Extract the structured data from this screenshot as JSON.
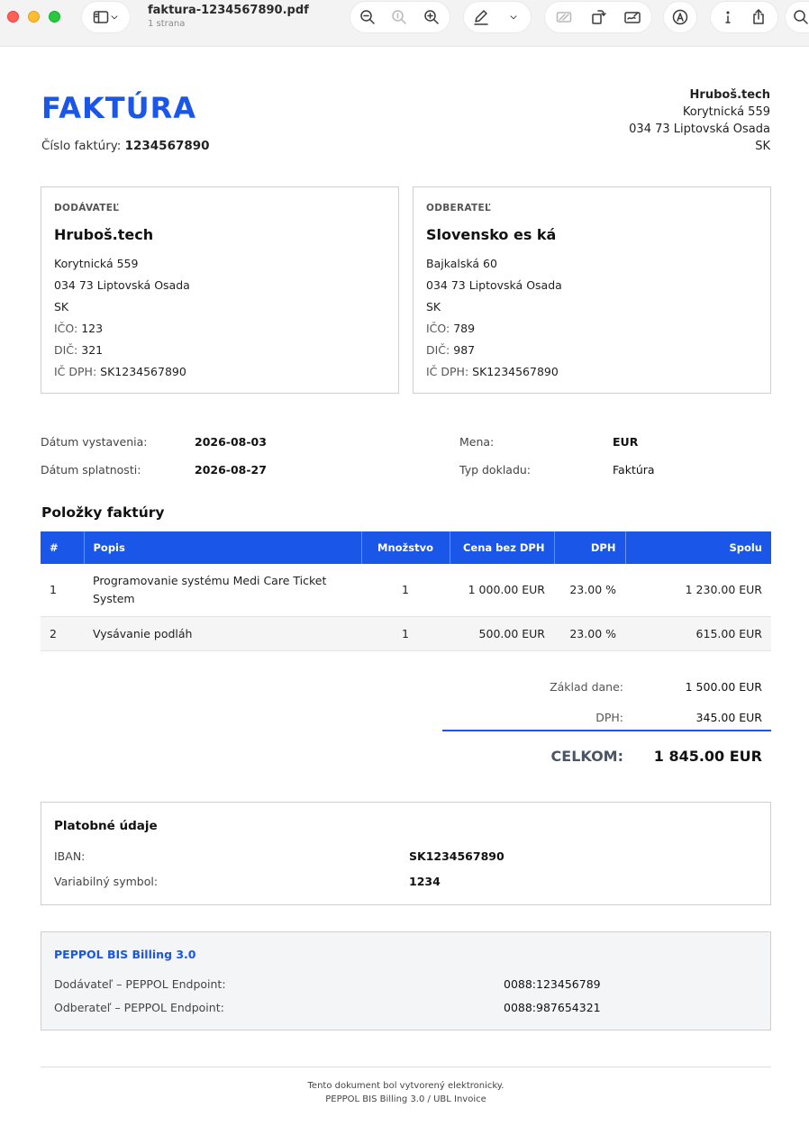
{
  "toolbar": {
    "file_name": "faktura-1234567890.pdf",
    "page_count": "1 strana"
  },
  "invoice": {
    "title": "FAKTÚRA",
    "number_label": "Číslo faktúry:",
    "number": "1234567890"
  },
  "header_right": {
    "name": "Hruboš.tech",
    "street": "Korytnická 559",
    "city": "034 73 Liptovská Osada",
    "country": "SK"
  },
  "supplier": {
    "label": "DODÁVATEĽ",
    "name": "Hruboš.tech",
    "street": "Korytnická 559",
    "city": "034 73 Liptovská Osada",
    "country": "SK",
    "ico_label": "IČO:",
    "ico": "123",
    "dic_label": "DIČ:",
    "dic": "321",
    "icdph_label": "IČ DPH:",
    "icdph": "SK1234567890"
  },
  "customer": {
    "label": "ODBERATEĽ",
    "name": "Slovensko es ká",
    "street": "Bajkalská 60",
    "city": "034 73 Liptovská Osada",
    "country": "SK",
    "ico_label": "IČO:",
    "ico": "789",
    "dic_label": "DIČ:",
    "dic": "987",
    "icdph_label": "IČ DPH:",
    "icdph": "SK1234567890"
  },
  "meta": {
    "issue_label": "Dátum vystavenia:",
    "issue_date": "2026-08-03",
    "due_label": "Dátum splatnosti:",
    "due_date": "2026-08-27",
    "currency_label": "Mena:",
    "currency": "EUR",
    "type_label": "Typ dokladu:",
    "type": "Faktúra"
  },
  "items": {
    "heading": "Položky faktúry",
    "columns": [
      "#",
      "Popis",
      "Množstvo",
      "Cena bez DPH",
      "DPH",
      "Spolu"
    ],
    "rows": [
      {
        "no": "1",
        "desc": "Programovanie systému Medi Care Ticket System",
        "qty": "1",
        "price": "1 000.00 EUR",
        "vat": "23.00 %",
        "total": "1 230.00 EUR"
      },
      {
        "no": "2",
        "desc": "Vysávanie podláh",
        "qty": "1",
        "price": "500.00 EUR",
        "vat": "23.00 %",
        "total": "615.00 EUR"
      }
    ]
  },
  "totals": {
    "base_label": "Základ dane:",
    "base": "1 500.00 EUR",
    "vat_label": "DPH:",
    "vat": "345.00 EUR",
    "total_label": "CELKOM:",
    "total": "1 845.00 EUR"
  },
  "payment": {
    "heading": "Platobné údaje",
    "iban_label": "IBAN:",
    "iban": "SK1234567890",
    "vs_label": "Variabilný symbol:",
    "vs": "1234"
  },
  "peppol": {
    "heading": "PEPPOL BIS Billing 3.0",
    "supplier_label": "Dodávateľ – PEPPOL Endpoint:",
    "supplier_endpoint": "0088:123456789",
    "customer_label": "Odberateľ – PEPPOL Endpoint:",
    "customer_endpoint": "0088:987654321"
  },
  "footer": {
    "line1": "Tento dokument bol vytvorený elektronicky.",
    "line2": "PEPPOL BIS Billing 3.0 / UBL Invoice"
  },
  "colors": {
    "accent": "#1a56e8",
    "traffic_red": "#fe5f57",
    "traffic_yellow": "#febc2e",
    "traffic_green": "#28c840"
  }
}
